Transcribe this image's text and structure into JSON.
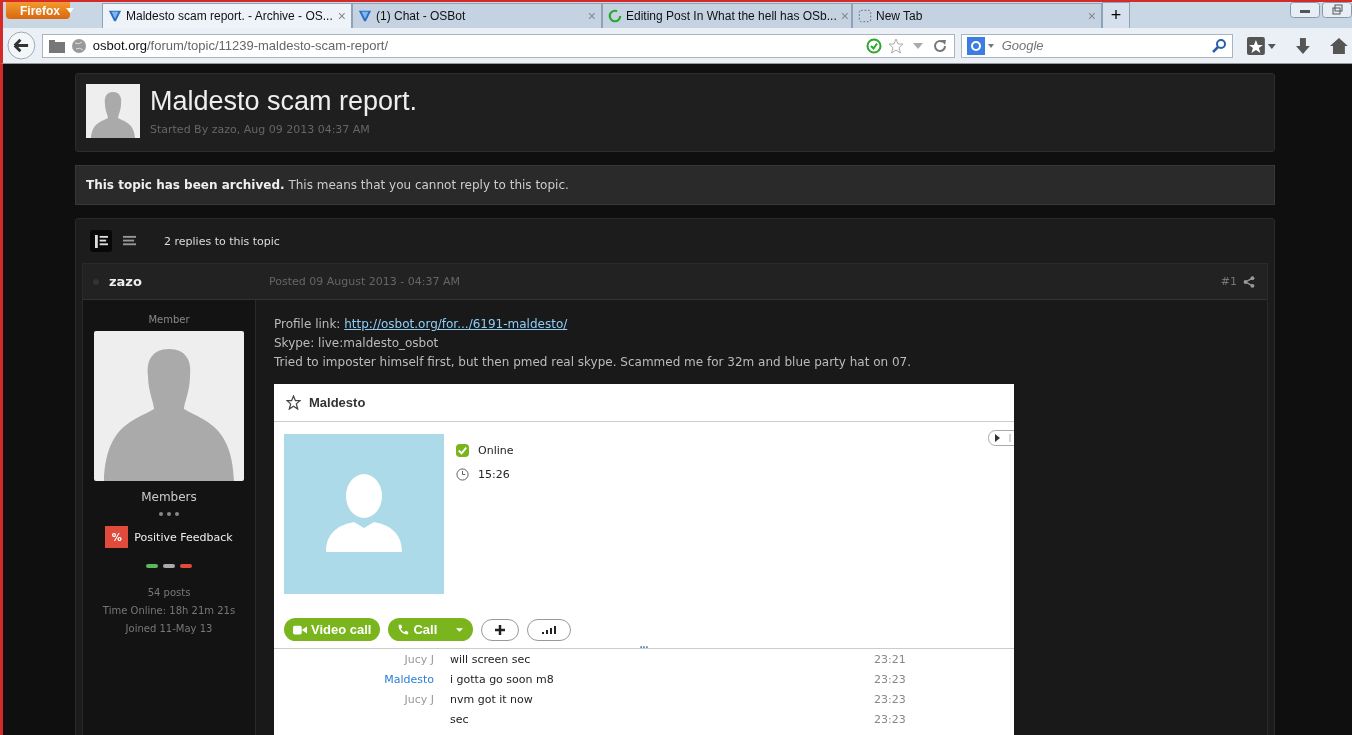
{
  "browser": {
    "menu_button": "Firefox",
    "tabs": [
      {
        "title": "Maldesto scam report. - Archive - OS...",
        "kind": "osbot",
        "selected": true,
        "close": "×"
      },
      {
        "title": "(1) Chat - OSBot",
        "kind": "osbot",
        "selected": false,
        "close": "×"
      },
      {
        "title": "Editing Post In What the hell has OSb...",
        "kind": "loading",
        "selected": false,
        "close": "×"
      },
      {
        "title": "New Tab",
        "kind": "blank",
        "selected": false,
        "close": "×"
      }
    ],
    "new_tab": "+",
    "address": {
      "domain": "osbot.org",
      "path": "/forum/topic/11239-maldesto-scam-report/"
    },
    "search": {
      "placeholder": "Google"
    }
  },
  "topic": {
    "title": "Maldesto scam report.",
    "meta": "Started By zazo, Aug 09 2013 04:37 AM"
  },
  "notice": "**This topic has been archived.** This means that you cannot reply to this topic.",
  "replies": {
    "views": [
      {
        "kind": "full",
        "selected": true
      },
      {
        "kind": "list",
        "selected": false
      }
    ],
    "count": "2 replies to this topic"
  },
  "post": {
    "author": "zazo",
    "posted": "Posted 09 August 2013 - 04:37 AM",
    "number": "#1",
    "rank": "Member",
    "group": "Members",
    "feedback_badge": "%",
    "feedback_label": "Positive Feedback",
    "stats": [
      "54 posts",
      "Time Online: 18h 21m 21s",
      "Joined 11-May 13"
    ],
    "profile_label": "Profile link:",
    "profile_link": "http://osbot.org/for.../6191-maldesto/",
    "skype_line": "Skype: live:maldesto_osbot",
    "text": "Tried to imposter himself first, but then pmed real skype. Scammed me for 32m and blue party hat on 07.",
    "screenshot": {
      "name": "Maldesto",
      "status": "Online",
      "local_time": "15:26",
      "video_button": "Video call",
      "call_button": "Call",
      "more": "...",
      "messages": [
        {
          "sender": "Jucy J",
          "color": "#999999",
          "text": "will screen sec",
          "time": "23:21"
        },
        {
          "sender": "Maldesto",
          "color": "#2a7fd4",
          "text": "i gotta go soon m8",
          "time": "23:23"
        },
        {
          "sender": "Jucy J",
          "color": "#999999",
          "text": "nvm got it now",
          "time": "23:23"
        },
        {
          "text": "sec",
          "time": "23:23"
        }
      ]
    }
  }
}
